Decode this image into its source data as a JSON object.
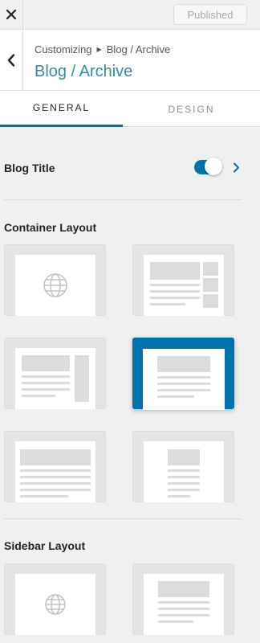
{
  "topbar": {
    "close_icon": "close-icon",
    "publish_label": "Published"
  },
  "header": {
    "back_icon": "chevron-left-icon",
    "breadcrumb_root": "Customizing",
    "breadcrumb_separator_icon": "triangle-right-icon",
    "breadcrumb_current": "Blog / Archive",
    "title": "Blog / Archive"
  },
  "tabs": [
    {
      "label": "GENERAL",
      "active": true
    },
    {
      "label": "DESIGN",
      "active": false
    }
  ],
  "blog_title": {
    "label": "Blog Title",
    "enabled": true,
    "expand_icon": "chevron-right-icon"
  },
  "container_layout": {
    "label": "Container Layout",
    "options": [
      {
        "id": "default",
        "icon": "globe-icon",
        "selected": false
      },
      {
        "id": "boxed",
        "icon": "layout-boxed-icon",
        "selected": false
      },
      {
        "id": "content-boxed",
        "icon": "layout-content-boxed-icon",
        "selected": false
      },
      {
        "id": "full-width-contained",
        "icon": "layout-full-width-contained-icon",
        "selected": true
      },
      {
        "id": "full-width-stretched",
        "icon": "layout-full-width-stretched-icon",
        "selected": false
      },
      {
        "id": "narrow-width",
        "icon": "layout-narrow-icon",
        "selected": false
      }
    ]
  },
  "sidebar_layout": {
    "label": "Sidebar Layout",
    "options": [
      {
        "id": "default",
        "icon": "globe-icon",
        "selected": false
      },
      {
        "id": "no-sidebar",
        "icon": "layout-no-sidebar-icon",
        "selected": false
      }
    ]
  },
  "colors": {
    "accent": "#0073aa",
    "title": "#3c8a9c",
    "background": "#f0f0f1"
  }
}
